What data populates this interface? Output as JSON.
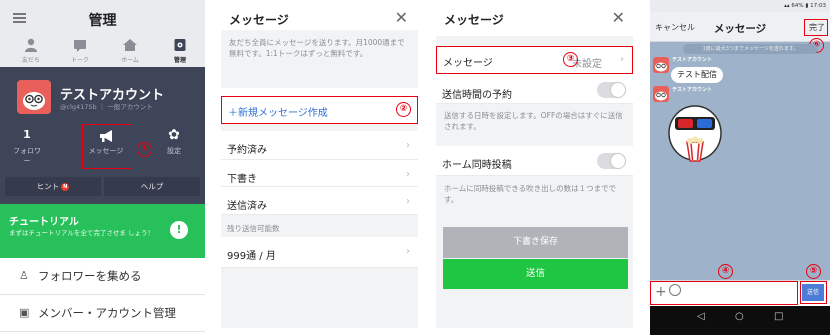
{
  "screen1": {
    "title": "管理",
    "nav": [
      {
        "label": "友だち",
        "icon": "person-icon"
      },
      {
        "label": "トーク",
        "icon": "chat-icon"
      },
      {
        "label": "ホーム",
        "icon": "home-icon"
      },
      {
        "label": "管理",
        "icon": "manage-icon"
      }
    ],
    "account_name": "テストアカウント",
    "account_id": "@clg4175b",
    "account_type": "一般アカウント",
    "followers_count": "1",
    "followers_label": "フォロワー",
    "message_label": "メッセージ",
    "settings_label": "設定",
    "hint_label": "ヒント",
    "hint_badge": "N",
    "help_label": "ヘルプ",
    "tutorial_title": "チュートリアル",
    "tutorial_text": "まずはチュートリアルを全て完了させま しょう！",
    "tutorial_icon": "!",
    "menu": [
      {
        "label": "フォロワーを集める",
        "icon": "add-follower-icon"
      },
      {
        "label": "メンバー・アカウント管理",
        "icon": "member-icon"
      }
    ],
    "annotation": "①"
  },
  "screen2": {
    "title": "メッセージ",
    "description": "友だち全員にメッセージを送ります。月1000通まで無料です。1:1トークはずっと無料です。",
    "new_message": "＋新規メッセージ作成",
    "annotation": "②",
    "rows": [
      "予約済み",
      "下書き",
      "送信済み"
    ],
    "remaining_label": "残り送信可能数",
    "remaining_value": "999通 / 月"
  },
  "screen3": {
    "title": "メッセージ",
    "message_label": "メッセージ",
    "message_status": "未設定",
    "annotation": "③",
    "schedule_label": "送信時間の予約",
    "schedule_desc": "送信する日時を設定します。OFFの場合はすぐに送信されます。",
    "home_label": "ホーム同時投稿",
    "home_desc": "ホームに同時投稿できる吹き出しの数は１つまでです。",
    "draft_button": "下書き保存",
    "send_button": "送信"
  },
  "screen4": {
    "status": "17:03",
    "battery": "64%",
    "cancel": "キャンセル",
    "title": "メッセージ",
    "done": "完了",
    "annotation_done": "⑥",
    "note": "1度に最大3つまでメッセージを送れます。",
    "sender": "テストアカウント",
    "bubble_text": "テスト配信",
    "annotation_input": "④",
    "annotation_send": "⑤",
    "send": "送信"
  },
  "colors": {
    "annotation_red": "#e60012",
    "line_green": "#1ec641",
    "dark_panel": "#3e4558",
    "chat_bg": "#9eb3c9",
    "send_blue": "#4c7cd6"
  }
}
